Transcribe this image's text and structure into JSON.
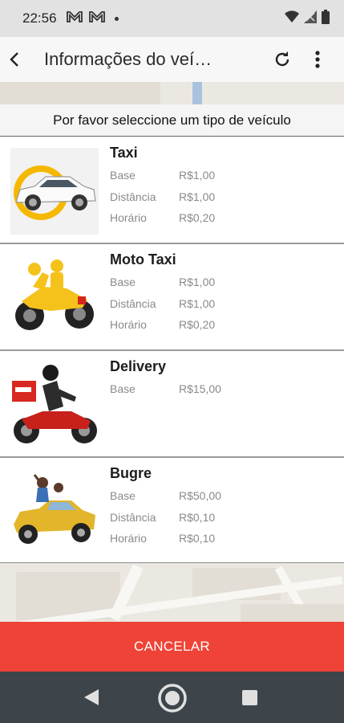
{
  "status_bar": {
    "time": "22:56",
    "icons": [
      "gmail-icon",
      "gmail-icon",
      "dot-icon",
      "wifi-icon",
      "signal-icon",
      "battery-icon"
    ]
  },
  "app_bar": {
    "title": "Informações do veí…",
    "icons": [
      "back-arrow-icon",
      "refresh-icon",
      "more-vert-icon"
    ]
  },
  "prompt": "Por favor seleccione um tipo de veículo",
  "vehicles": [
    {
      "name": "Taxi",
      "image": "taxi-car-icon",
      "fares": [
        {
          "label": "Base",
          "value": "R$1,00"
        },
        {
          "label": "Distância",
          "value": "R$1,00"
        },
        {
          "label": "Horário",
          "value": "R$0,20"
        }
      ]
    },
    {
      "name": "Moto Taxi",
      "image": "motorcycle-icon",
      "fares": [
        {
          "label": "Base",
          "value": "R$1,00"
        },
        {
          "label": "Distância",
          "value": "R$1,00"
        },
        {
          "label": "Horário",
          "value": "R$0,20"
        }
      ]
    },
    {
      "name": "Delivery",
      "image": "delivery-motorcycle-icon",
      "fares": [
        {
          "label": "Base",
          "value": "R$15,00"
        }
      ]
    },
    {
      "name": "Bugre",
      "image": "buggy-icon",
      "fares": [
        {
          "label": "Base",
          "value": "R$50,00"
        },
        {
          "label": "Distância",
          "value": "R$0,10"
        },
        {
          "label": "Horário",
          "value": "R$0,10"
        }
      ]
    }
  ],
  "cancel_label": "CANCELAR",
  "colors": {
    "cancel": "#ee4336",
    "nav_bar": "#3d454a",
    "status_bar": "#e2e2e2"
  }
}
